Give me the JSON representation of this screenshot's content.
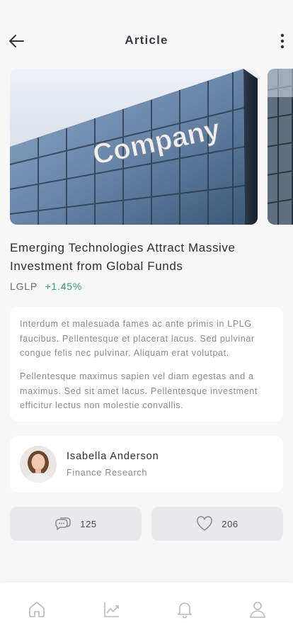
{
  "header": {
    "title": "Article",
    "back_icon": "arrow-left-icon",
    "more_icon": "more-vertical-icon"
  },
  "gallery": {
    "images": [
      {
        "sign_text": "Company"
      },
      {
        "sign_text": ""
      }
    ]
  },
  "article": {
    "headline": "Emerging Technologies Attract Massive Investment from Global Funds",
    "ticker": "LGLP",
    "change": "+1.45%",
    "paragraphs": [
      "Interdum et malesuada fames ac ante primis in LPLG faucibus. Pellentesque et placerat lacus. Sed pulvinar congue felis nec pulvinar. Aliquam erat volutpat.",
      "Pellentesque maximus sapien vel diam egestas and a maximus. Sed sit amet lacus. Pellentesque investment efficitur lectus non molestie convallis."
    ]
  },
  "author": {
    "name": "Isabella Anderson",
    "role": "Finance Research"
  },
  "stats": {
    "comments": "125",
    "likes": "206"
  },
  "tabbar": {
    "items": [
      "home-icon",
      "chart-icon",
      "bell-icon",
      "user-icon"
    ]
  },
  "colors": {
    "accent_green": "#3d9b6b",
    "background": "#f7f7f8",
    "card": "#ffffff",
    "button": "#e8e8ed"
  }
}
